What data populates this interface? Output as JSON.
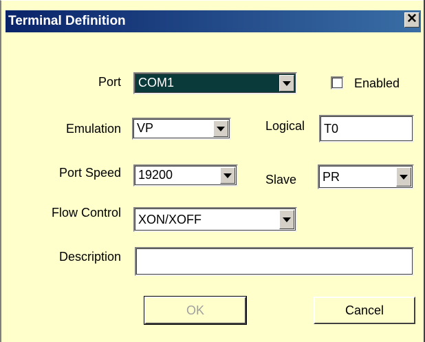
{
  "window": {
    "title": "Terminal Definition",
    "close_label": "✕"
  },
  "colors": {
    "background": "#ffffcc",
    "titlebar_start": "#0a246a",
    "titlebar_end": "#3a6ea5",
    "selected_field": "#0a3a3a"
  },
  "form": {
    "port": {
      "label": "Port",
      "value": "COM1"
    },
    "enabled": {
      "label": "Enabled",
      "checked": false
    },
    "emulation": {
      "label": "Emulation",
      "value": "VP"
    },
    "logical": {
      "label": "Logical",
      "value": "T0"
    },
    "port_speed": {
      "label": "Port Speed",
      "value": "19200"
    },
    "slave": {
      "label": "Slave",
      "value": "PR"
    },
    "flow_control": {
      "label": "Flow Control",
      "value": "XON/XOFF"
    },
    "description": {
      "label": "Description",
      "value": ""
    }
  },
  "buttons": {
    "ok": "OK",
    "cancel": "Cancel"
  },
  "icons": {
    "close": "close-icon",
    "dropdown": "chevron-down-icon"
  }
}
